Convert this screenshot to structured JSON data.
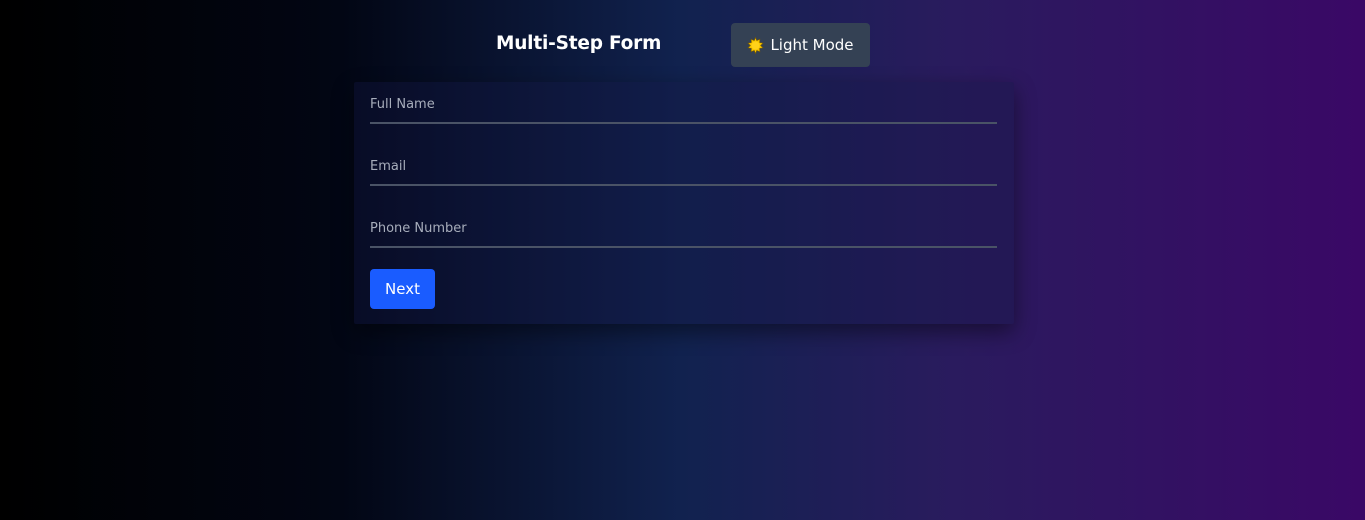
{
  "header": {
    "title": "Multi-Step Form",
    "mode_toggle": {
      "label": "Light Mode",
      "icon": "sun-icon"
    }
  },
  "form": {
    "fields": [
      {
        "placeholder": "Full Name",
        "value": ""
      },
      {
        "placeholder": "Email",
        "value": ""
      },
      {
        "placeholder": "Phone Number",
        "value": ""
      }
    ],
    "next_label": "Next"
  },
  "colors": {
    "primary_button": "#1a5cff",
    "toggle_button": "#344154",
    "sun": "#f7c600",
    "field_underline": "#4a5366"
  }
}
